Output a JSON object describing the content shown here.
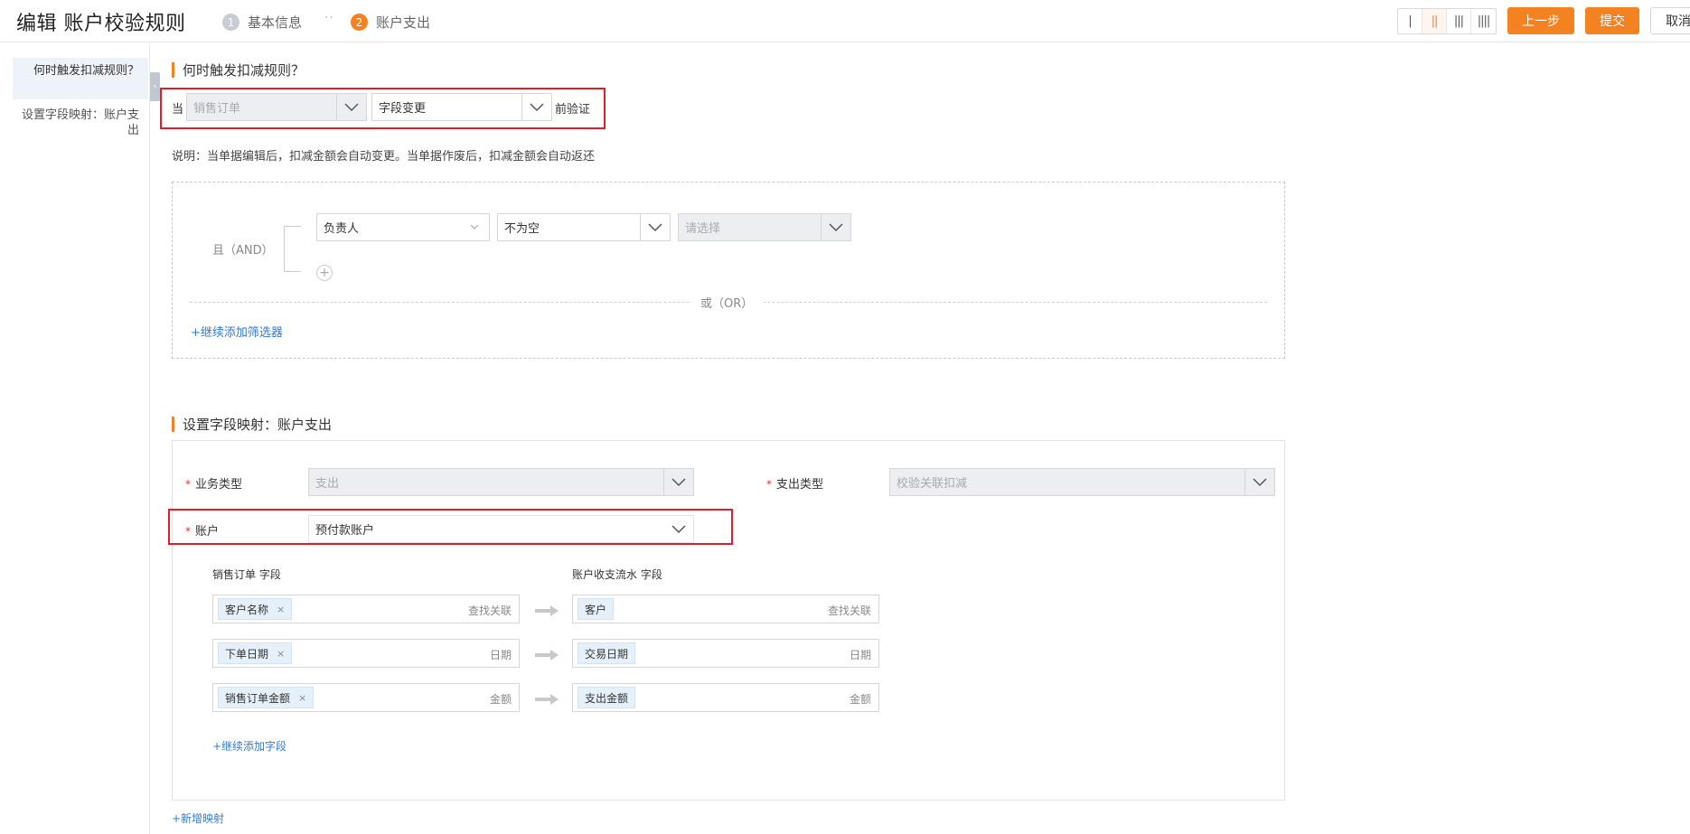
{
  "header": {
    "title": "编辑 账户校验规则",
    "steps": [
      {
        "num": "1",
        "label": "基本信息"
      },
      {
        "num": "2",
        "label": "账户支出"
      }
    ],
    "step_separator": "··",
    "column_modes": [
      "|",
      "||",
      "|||",
      "||||"
    ],
    "prev_label": "上一步",
    "submit_label": "提交",
    "cancel_label": "取消"
  },
  "sidebar": {
    "items": [
      {
        "label": "何时触发扣减规则？"
      },
      {
        "label": "设置字段映射：账户支出"
      }
    ],
    "collapse_glyph": "‹"
  },
  "trigger": {
    "title": "何时触发扣减规则？",
    "prefix": "当",
    "object_value": "销售订单",
    "event_value": "字段变更",
    "suffix": "前验证",
    "note": "说明：当单据编辑后，扣减金额会自动变更。当单据作废后，扣减金额会自动返还",
    "and_label": "且（AND）",
    "condition": {
      "field": "负责人",
      "operator": "不为空",
      "value_placeholder": "请选择"
    },
    "add_condition_glyph": "+",
    "or_label": "或（OR）",
    "add_filter_label": "+继续添加筛选器"
  },
  "mapping": {
    "title": "设置字段映射：账户支出",
    "business_type_label": "业务类型",
    "business_type_value": "支出",
    "expense_type_label": "支出类型",
    "expense_type_value": "校验关联扣减",
    "account_label": "账户",
    "account_value": "预付款账户",
    "required_mark": "*",
    "left_header": "销售订单 字段",
    "right_header": "账户收支流水 字段",
    "rows": [
      {
        "left_tag": "客户名称",
        "left_kind": "查找关联",
        "right_tag": "客户",
        "right_kind": "查找关联"
      },
      {
        "left_tag": "下单日期",
        "left_kind": "日期",
        "right_tag": "交易日期",
        "right_kind": "日期"
      },
      {
        "left_tag": "销售订单金额",
        "left_kind": "金额",
        "right_tag": "支出金额",
        "right_kind": "金额"
      }
    ],
    "tag_remove_glyph": "×",
    "add_field_label": "+继续添加字段",
    "add_mapping_label": "+新增映射"
  }
}
